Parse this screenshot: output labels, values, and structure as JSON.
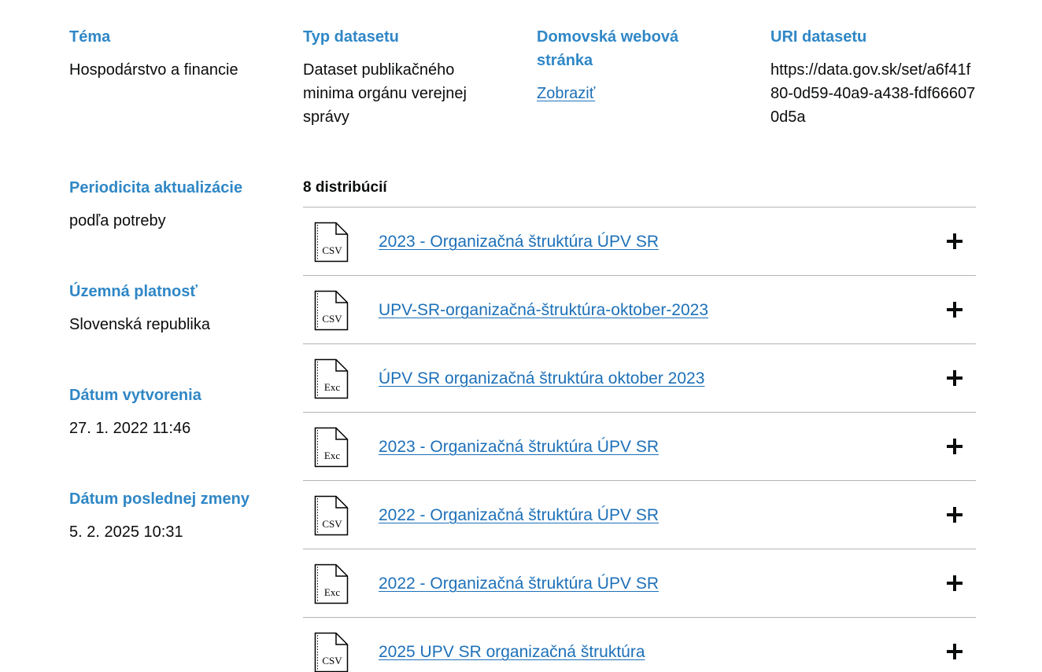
{
  "meta": {
    "tema": {
      "label": "Téma",
      "value": "Hospodárstvo a financie"
    },
    "typ": {
      "label": "Typ datasetu",
      "value": "Dataset publikačného minima orgánu verejnej správy"
    },
    "domovska": {
      "label": "Domovská webová stránka",
      "link": "Zobraziť"
    },
    "uri": {
      "label": "URI datasetu",
      "value": "https://data.gov.sk/set/a6f41f80-0d59-40a9-a438-fdf666070d5a"
    },
    "periodicita": {
      "label": "Periodicita aktualizácie",
      "value": "podľa potreby"
    },
    "uzemna": {
      "label": "Územná platnosť",
      "value": "Slovenská republika"
    },
    "vytvorenie": {
      "label": "Dátum vytvorenia",
      "value": "27. 1. 2022 11:46"
    },
    "zmena": {
      "label": "Dátum poslednej zmeny",
      "value": "5. 2. 2025 10:31"
    }
  },
  "distributions": {
    "count_label": "8 distribúcií",
    "items": [
      {
        "format": "CSV",
        "title": "2023 - Organizačná štruktúra ÚPV SR",
        "icon": "csv-file-icon"
      },
      {
        "format": "CSV",
        "title": "UPV-SR-organizačná-štruktúra-oktober-2023",
        "icon": "csv-file-icon"
      },
      {
        "format": "Exc",
        "title": "ÚPV SR organizačná štruktúra oktober 2023",
        "icon": "excel-file-icon"
      },
      {
        "format": "Exc",
        "title": "2023 - Organizačná štruktúra ÚPV SR",
        "icon": "excel-file-icon"
      },
      {
        "format": "CSV",
        "title": "2022 - Organizačná štruktúra ÚPV SR",
        "icon": "csv-file-icon"
      },
      {
        "format": "Exc",
        "title": "2022 - Organizačná štruktúra ÚPV SR",
        "icon": "excel-file-icon"
      },
      {
        "format": "CSV",
        "title": "2025 UPV SR organizačná štruktúra",
        "icon": "csv-file-icon"
      }
    ]
  },
  "colors": {
    "label": "#2f87c6",
    "link": "#1d70b8",
    "text": "#0b0c0c",
    "divider": "#b1b4b6"
  }
}
